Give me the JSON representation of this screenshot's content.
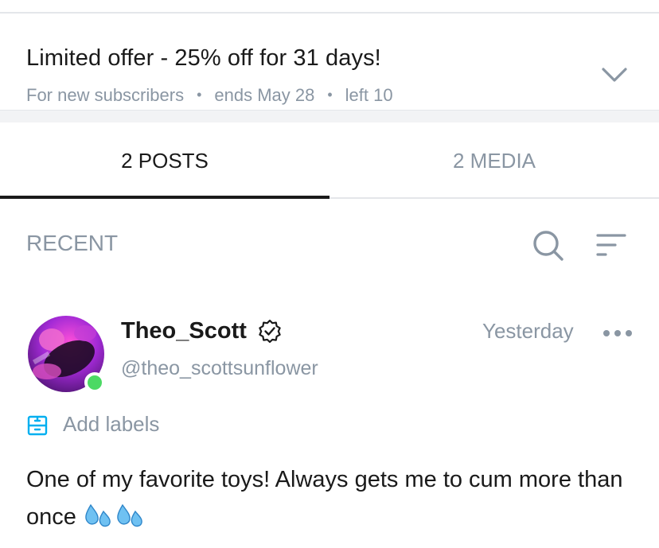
{
  "offer": {
    "title": "Limited offer - 25% off for 31 days!",
    "audience": "For new subscribers",
    "ends": "ends May 28",
    "left": "left 10",
    "expand_icon": "chevron-down-icon"
  },
  "tabs": [
    {
      "label": "2 POSTS",
      "active": true
    },
    {
      "label": "2 MEDIA",
      "active": false
    }
  ],
  "feed": {
    "section_label": "RECENT",
    "search_icon": "search-icon",
    "sort_icon": "sort-icon"
  },
  "post": {
    "author_name": "Theo_Scott",
    "author_handle": "@theo_scottsunflower",
    "verified_icon": "verified-badge-icon",
    "timestamp": "Yesterday",
    "more_icon": "more-dots-icon",
    "online": true,
    "add_labels": "Add labels",
    "label_icon": "label-icon",
    "text": "One of my favorite toys! Always gets me to cum more than once",
    "emoji_icon": "sweat-droplets-icon"
  },
  "colors": {
    "text_primary": "#1a1a1a",
    "text_secondary": "#8a96a3",
    "accent_blue": "#00aff0",
    "online_green": "#4cd964",
    "divider": "#e4e6ea"
  }
}
